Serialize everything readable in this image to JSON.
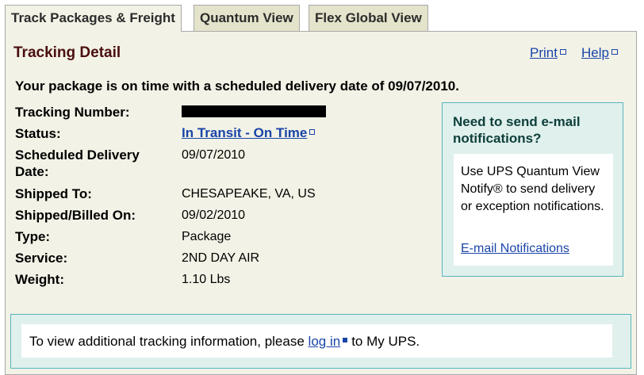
{
  "tabs": [
    {
      "label": "Track Packages & Freight",
      "active": true
    },
    {
      "label": "Quantum View",
      "active": false
    },
    {
      "label": "Flex Global View",
      "active": false
    }
  ],
  "header": {
    "title": "Tracking Detail",
    "print_label": "Print",
    "help_label": "Help"
  },
  "headline": "Your package is on time with a scheduled delivery date of 09/07/2010.",
  "details": {
    "tracking_number": {
      "label": "Tracking Number:"
    },
    "status": {
      "label": "Status:",
      "value": "In Transit - On Time"
    },
    "scheduled_delivery": {
      "label_line1": "Scheduled Delivery",
      "label_line2": "Date:",
      "value": "09/07/2010"
    },
    "shipped_to": {
      "label": "Shipped To:",
      "value": "CHESAPEAKE, VA, US"
    },
    "shipped_billed_on": {
      "label": "Shipped/Billed On:",
      "value": "09/02/2010"
    },
    "type": {
      "label": "Type:",
      "value": "Package"
    },
    "service": {
      "label": "Service:",
      "value": "2ND DAY AIR"
    },
    "weight": {
      "label": "Weight:",
      "value": "1.10 Lbs"
    }
  },
  "notification": {
    "title": "Need to send e-mail notifications?",
    "text": "Use UPS Quantum View Notify® to send delivery or exception notifications.",
    "link_label": "E-mail Notifications"
  },
  "bottom": {
    "text_before": "To view additional tracking information, please",
    "link_label": "log in",
    "text_after": "to My UPS."
  },
  "colors": {
    "link": "#1a45a8",
    "title": "#4b0e0e",
    "panel_bg": "#f2f2e6",
    "tab_bg": "#e4e3cb",
    "notify_bg": "#dff0ed",
    "notify_border": "#58b5bd"
  }
}
